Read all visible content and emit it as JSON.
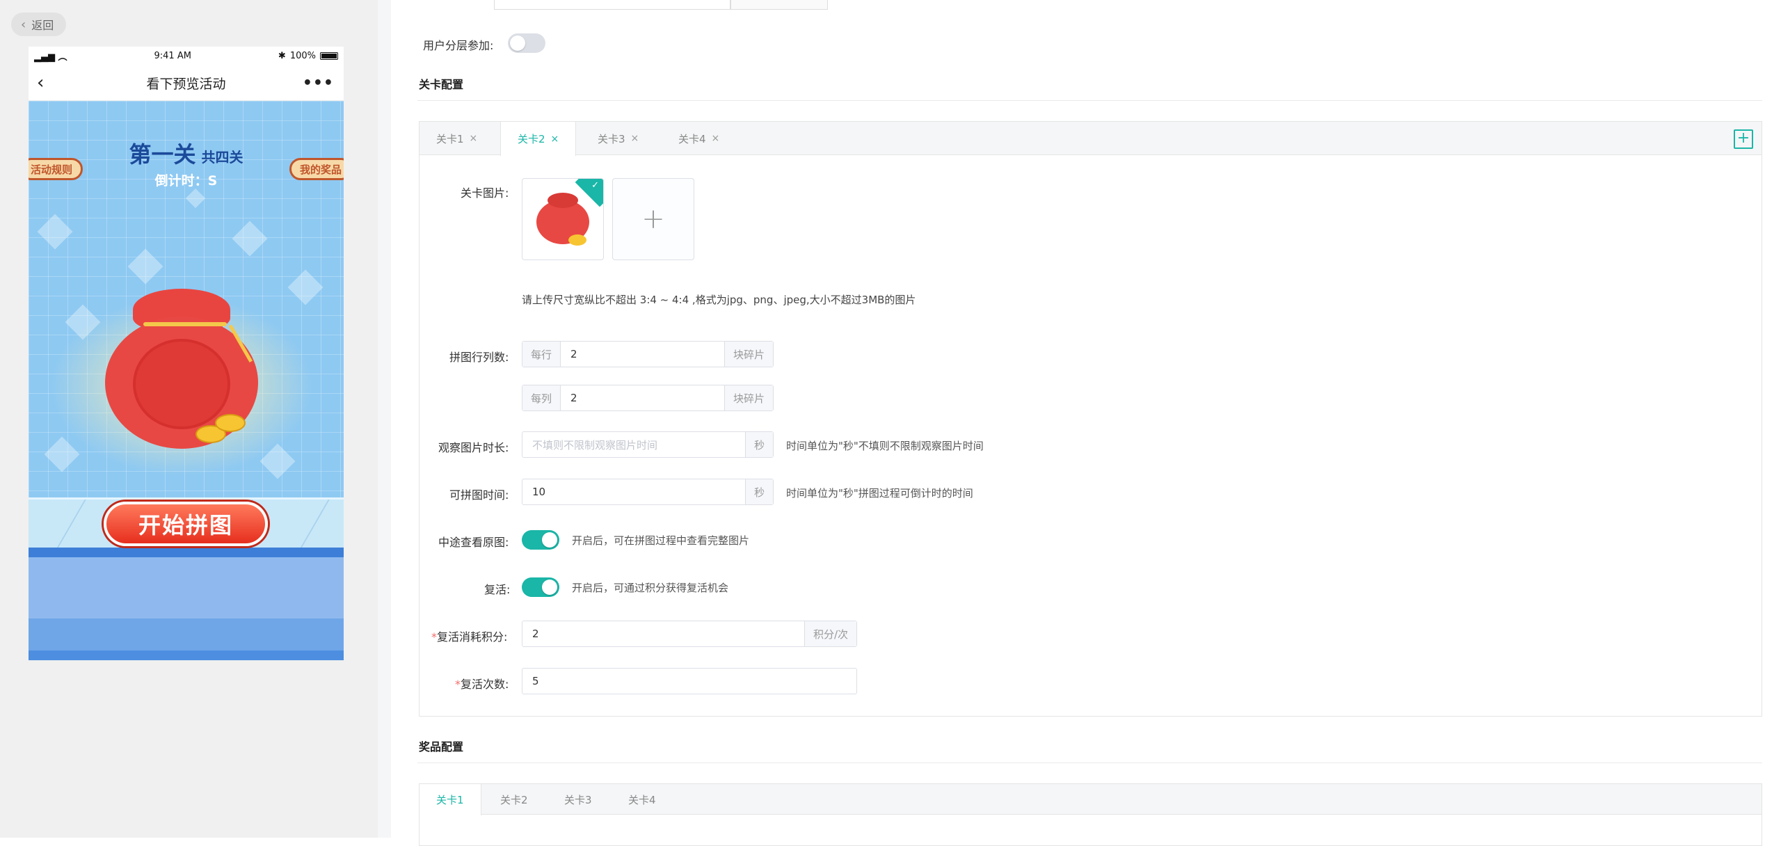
{
  "back_button": "返回",
  "phone": {
    "status": {
      "time": "9:41 AM",
      "battery": "100%"
    },
    "nav_title": "看下预览活动",
    "nav_more": "•••",
    "level_main": "第一关",
    "level_sub": "共四关",
    "countdown": "倒计时：S",
    "left_side_btn": "活动规则",
    "right_side_btn": "我的奖品",
    "start_button": "开始拼图"
  },
  "form": {
    "layered_label": "用户分层参加:",
    "level_config_title": "关卡配置",
    "level_tabs": [
      {
        "label": "关卡1",
        "close": "×"
      },
      {
        "label": "关卡2",
        "close": "×"
      },
      {
        "label": "关卡3",
        "close": "×"
      },
      {
        "label": "关卡4",
        "close": "×"
      }
    ],
    "add_tab": "+",
    "image_label": "关卡图片:",
    "upload_add": "+",
    "upload_hint": "请上传尺寸宽纵比不超出 3:4 ~ 4:4 ,格式为jpg、png、jpeg,大小不超过3MB的图片",
    "grid_label": "拼图行列数:",
    "rows": {
      "prefix": "每行",
      "value": "2",
      "suffix": "块碎片"
    },
    "cols": {
      "prefix": "每列",
      "value": "2",
      "suffix": "块碎片"
    },
    "observe_label": "观察图片时长:",
    "observe": {
      "placeholder": "不填则不限制观察图片时间",
      "suffix": "秒",
      "hint": "时间单位为\"秒\"不填则不限制观察图片时间"
    },
    "puzzle_time_label": "可拼图时间:",
    "puzzle_time": {
      "value": "10",
      "suffix": "秒",
      "hint": "时间单位为\"秒\"拼图过程可倒计时的时间"
    },
    "view_original_label": "中途查看原图:",
    "view_original_hint": "开启后，可在拼图过程中查看完整图片",
    "revive_label": "复活:",
    "revive_hint": "开启后，可通过积分获得复活机会",
    "revive_cost_star": "*",
    "revive_cost_label": "复活消耗积分:",
    "revive_cost": {
      "value": "2",
      "suffix": "积分/次"
    },
    "revive_times_star": "*",
    "revive_times_label": "复活次数:",
    "revive_times": {
      "value": "5"
    },
    "prize_config_title": "奖品配置",
    "prize_tabs": [
      "关卡1",
      "关卡2",
      "关卡3",
      "关卡4"
    ]
  }
}
